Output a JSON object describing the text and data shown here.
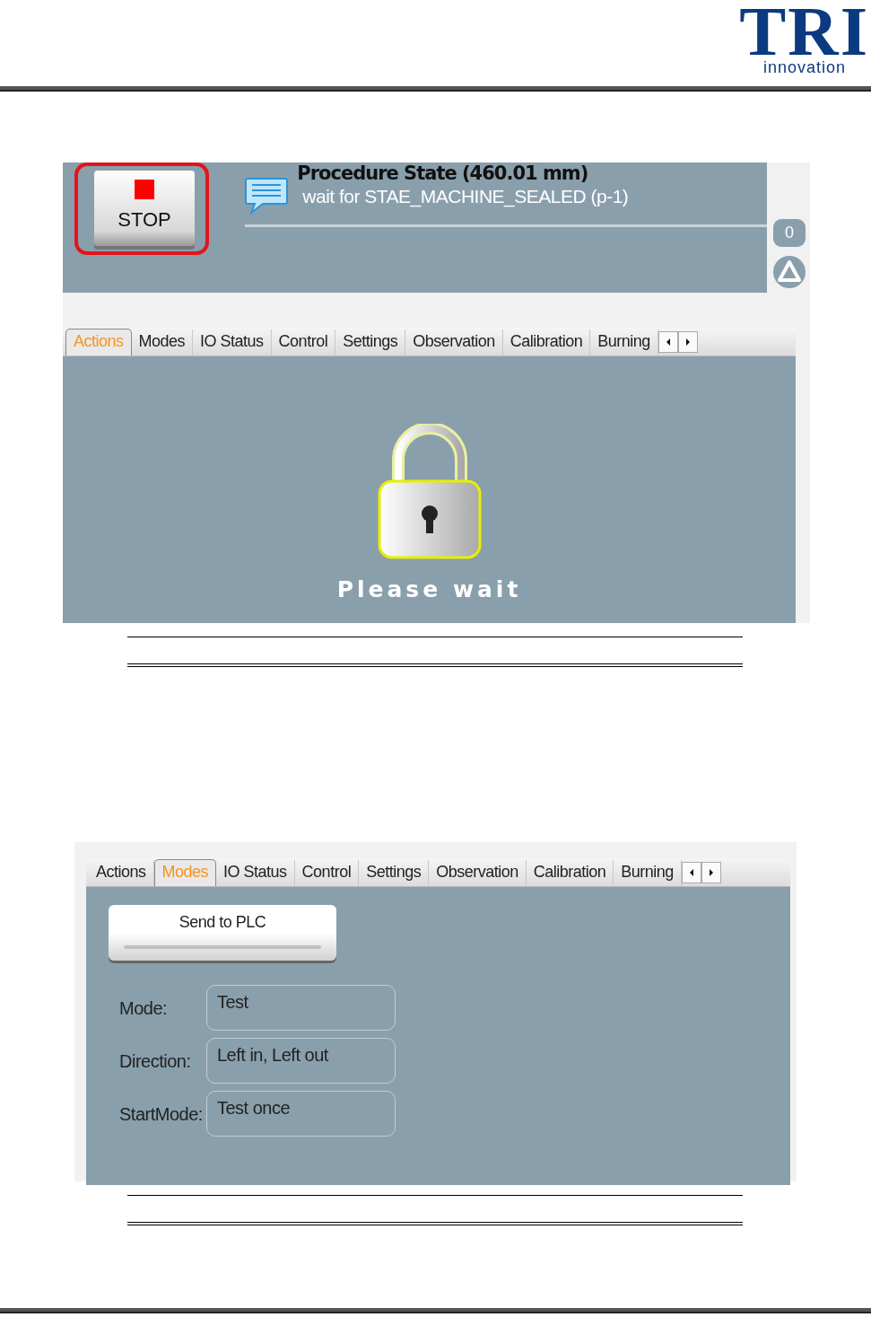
{
  "logo": {
    "mark": "TRI",
    "tagline": "innovation"
  },
  "screen_1": {
    "stop_button": {
      "label": "STOP",
      "highlighted": true
    },
    "procedure": {
      "title": "Procedure State (460.01 mm)",
      "message": "wait for STAE_MACHINE_SEALED (p-1)"
    },
    "side_button": {
      "label": "0"
    },
    "tabs": [
      {
        "label": "Actions",
        "selected": true
      },
      {
        "label": "Modes",
        "selected": false
      },
      {
        "label": "IO Status",
        "selected": false
      },
      {
        "label": "Control",
        "selected": false
      },
      {
        "label": "Settings",
        "selected": false
      },
      {
        "label": "Observation",
        "selected": false
      },
      {
        "label": "Calibration",
        "selected": false
      },
      {
        "label": "Burning",
        "selected": false
      }
    ],
    "wait_text": "Please wait"
  },
  "screen_2": {
    "tabs": [
      {
        "label": "Actions",
        "selected": false
      },
      {
        "label": "Modes",
        "selected": true
      },
      {
        "label": "IO Status",
        "selected": false
      },
      {
        "label": "Control",
        "selected": false
      },
      {
        "label": "Settings",
        "selected": false
      },
      {
        "label": "Observation",
        "selected": false
      },
      {
        "label": "Calibration",
        "selected": false
      },
      {
        "label": "Burning",
        "selected": false
      }
    ],
    "send_button": {
      "label": "Send to PLC"
    },
    "fields": [
      {
        "label": "Mode:",
        "value": "Test"
      },
      {
        "label": "Direction:",
        "value": "Left in, Left out"
      },
      {
        "label": "StartMode:",
        "value": "Test once"
      }
    ]
  }
}
